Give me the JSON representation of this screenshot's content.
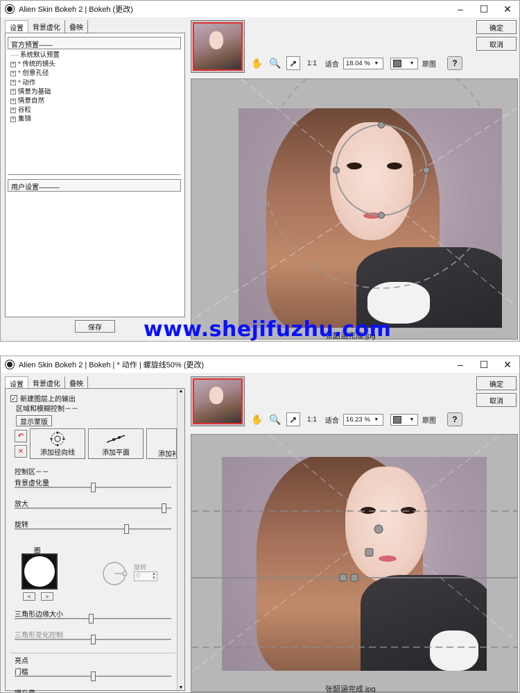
{
  "window1": {
    "title": "Alien Skin Bokeh 2 | Bokeh (更改)",
    "tabs": [
      "设置",
      "背景虚化",
      "叠映"
    ],
    "official_presets_header": "官方预置——",
    "presets": [
      {
        "label": "系统默认预置",
        "expandable": false
      },
      {
        "label": "* 传统的镜头",
        "expandable": true
      },
      {
        "label": "* 创意孔径",
        "expandable": true
      },
      {
        "label": "* 动作",
        "expandable": true
      },
      {
        "label": "情景为基础",
        "expandable": true
      },
      {
        "label": "情景自然",
        "expandable": true
      },
      {
        "label": "谷粒",
        "expandable": true
      },
      {
        "label": "集锦",
        "expandable": true
      }
    ],
    "user_settings_header": "用户设置———",
    "save_label": "保存",
    "ok_label": "确定",
    "cancel_label": "取消",
    "toolbar": {
      "ratio": "1:1",
      "fit": "适合",
      "zoom": "18.04 %",
      "original": "原图"
    },
    "caption": "张韶涵完成.jpg",
    "watermark": "www.shejifuzhu.com"
  },
  "window2": {
    "title": "Alien Skin Bokeh 2 | Bokeh | * 动作 | 螺旋线50% (更改)",
    "tabs": [
      "设置",
      "背景虚化",
      "叠映"
    ],
    "new_layer_label": "新建图层上的输出",
    "new_layer_checked": true,
    "region_header": "区域和模糊控制－－",
    "show_mask_label": "显示蒙版",
    "add_radial_label": "添加径向线",
    "add_plane_label": "添加平面",
    "add_partial_label": "添加补",
    "control_area_header": "控制区－－",
    "sliders": [
      {
        "label": "背景虚化量",
        "value": 0.5
      },
      {
        "label": "放大",
        "value": 0.97
      },
      {
        "label": "旋转",
        "value": 0.72
      },
      {
        "label": "三角形边缘大小",
        "value": 0.49
      },
      {
        "label": "三角形变化控制",
        "value": 0.5
      }
    ],
    "aperture_label": "圈",
    "rotation_label": "旋转",
    "rotation_value": "0",
    "highlights_header": "亮点",
    "threshold_label": "门槛",
    "threshold_value": 0.5,
    "partial_label": "提升量",
    "ok_label": "确定",
    "cancel_label": "取消",
    "toolbar": {
      "ratio": "1:1",
      "fit": "适合",
      "zoom": "16.23 %",
      "original": "原图"
    },
    "caption": "张韶涵完成.jpg"
  },
  "colors": {
    "accent_red": "#e23030",
    "watermark_blue": "#0a10ff"
  }
}
